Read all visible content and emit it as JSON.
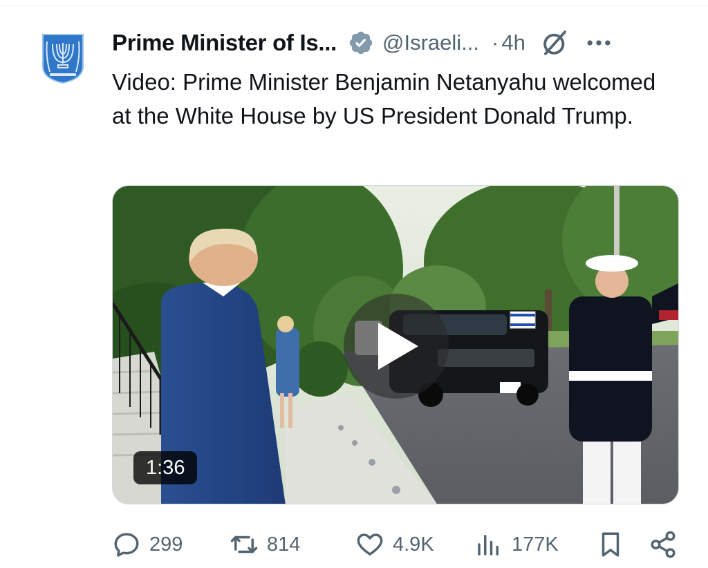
{
  "author": {
    "name": "Prime Minister of Is...",
    "handle": "@Israeli...",
    "separator": "·",
    "time": "4h",
    "avatar_icon": "menorah-emblem-icon",
    "verified_color": "#829aab"
  },
  "tweet": {
    "text": "Video: Prime Minister Benjamin Netanyahu welcomed at the White House by US President Donald Trump."
  },
  "media": {
    "type": "video",
    "duration": "1:36"
  },
  "actions": {
    "replies": "299",
    "reposts": "814",
    "likes": "4.9K",
    "views": "177K"
  },
  "colors": {
    "text_primary": "#0f1419",
    "text_secondary": "#536471",
    "avatar_blue": "#2f77c9"
  }
}
